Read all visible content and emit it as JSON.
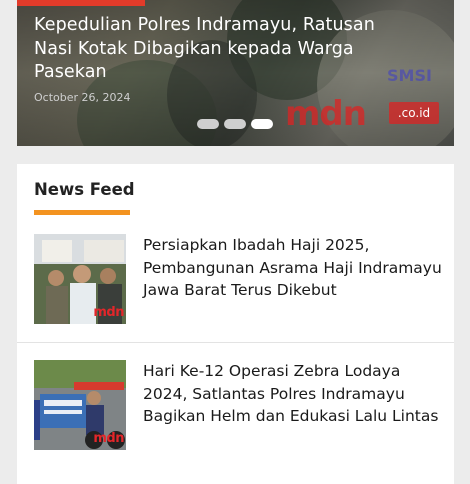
{
  "slider": {
    "title": "Kepedulian Polres Indramayu, Ratusan Nasi Kotak Dibagikan kepada Warga Pasekan",
    "date": "October 26, 2024",
    "watermark_brand": "mdn",
    "watermark_domain": ".co.id",
    "watermark_tag": "SMSI",
    "slide_count": 3,
    "active_slide": 3
  },
  "news_feed": {
    "heading": "News Feed",
    "accent_color": "#f39320",
    "items": [
      {
        "title": "Persiapkan Ibadah Haji 2025, Pembangunan Asrama Haji Indramayu Jawa Barat Terus Dikebut",
        "thumb_watermark": "mdn"
      },
      {
        "title": "Hari Ke-12 Operasi Zebra Lodaya 2024, Satlantas Polres Indramayu Bagikan Helm dan Edukasi Lalu Lintas",
        "thumb_watermark": "mdn"
      }
    ]
  },
  "colors": {
    "brand_red": "#e23b2a",
    "page_bg": "#ececec",
    "card_bg": "#ffffff"
  }
}
